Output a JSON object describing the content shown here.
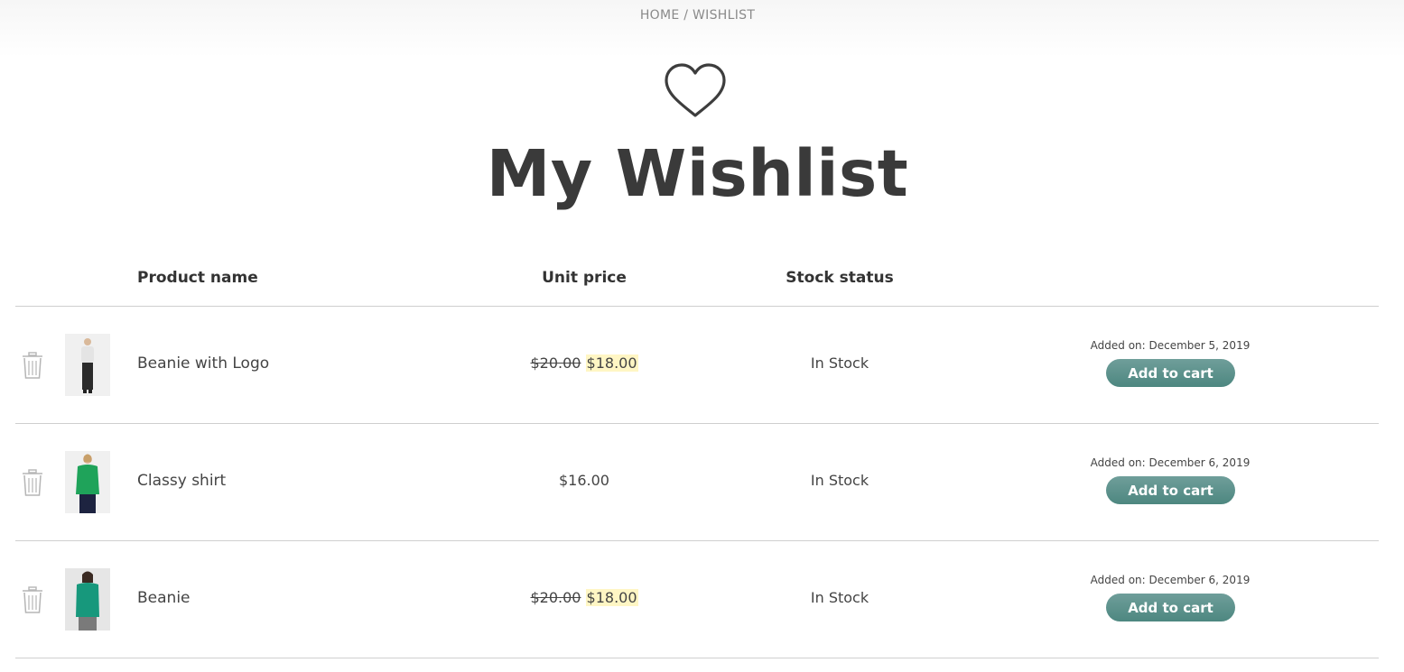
{
  "breadcrumb": {
    "home": "HOME",
    "separator": " / ",
    "current": "WISHLIST"
  },
  "header": {
    "icon": "heart-icon",
    "title": "My Wishlist"
  },
  "table": {
    "columns": {
      "product_name": "Product name",
      "unit_price": "Unit price",
      "stock_status": "Stock status"
    },
    "rows": [
      {
        "name": "Beanie with Logo",
        "old_price": "$20.00",
        "price": "$18.00",
        "stock": "In Stock",
        "added": "Added on: December 5, 2019",
        "button": "Add to cart",
        "thumb_colors": {
          "top": "#e4e4e4",
          "bottom": "#2b2b2b"
        }
      },
      {
        "name": "Classy shirt",
        "old_price": "",
        "price": "$16.00",
        "stock": "In Stock",
        "added": "Added on: December 6, 2019",
        "button": "Add to cart",
        "thumb_colors": {
          "top": "#1fa35a",
          "bottom": "#1d2340"
        }
      },
      {
        "name": "Beanie",
        "old_price": "$20.00",
        "price": "$18.00",
        "stock": "In Stock",
        "added": "Added on: December 6, 2019",
        "button": "Add to cart",
        "thumb_colors": {
          "top": "#17987c",
          "bottom": "#7a7a7a"
        }
      }
    ]
  },
  "colors": {
    "accent_button": "#5a918b",
    "sale_highlight": "#fff6c4",
    "title_text": "#3a3a3a",
    "divider": "#cfcfcf"
  }
}
